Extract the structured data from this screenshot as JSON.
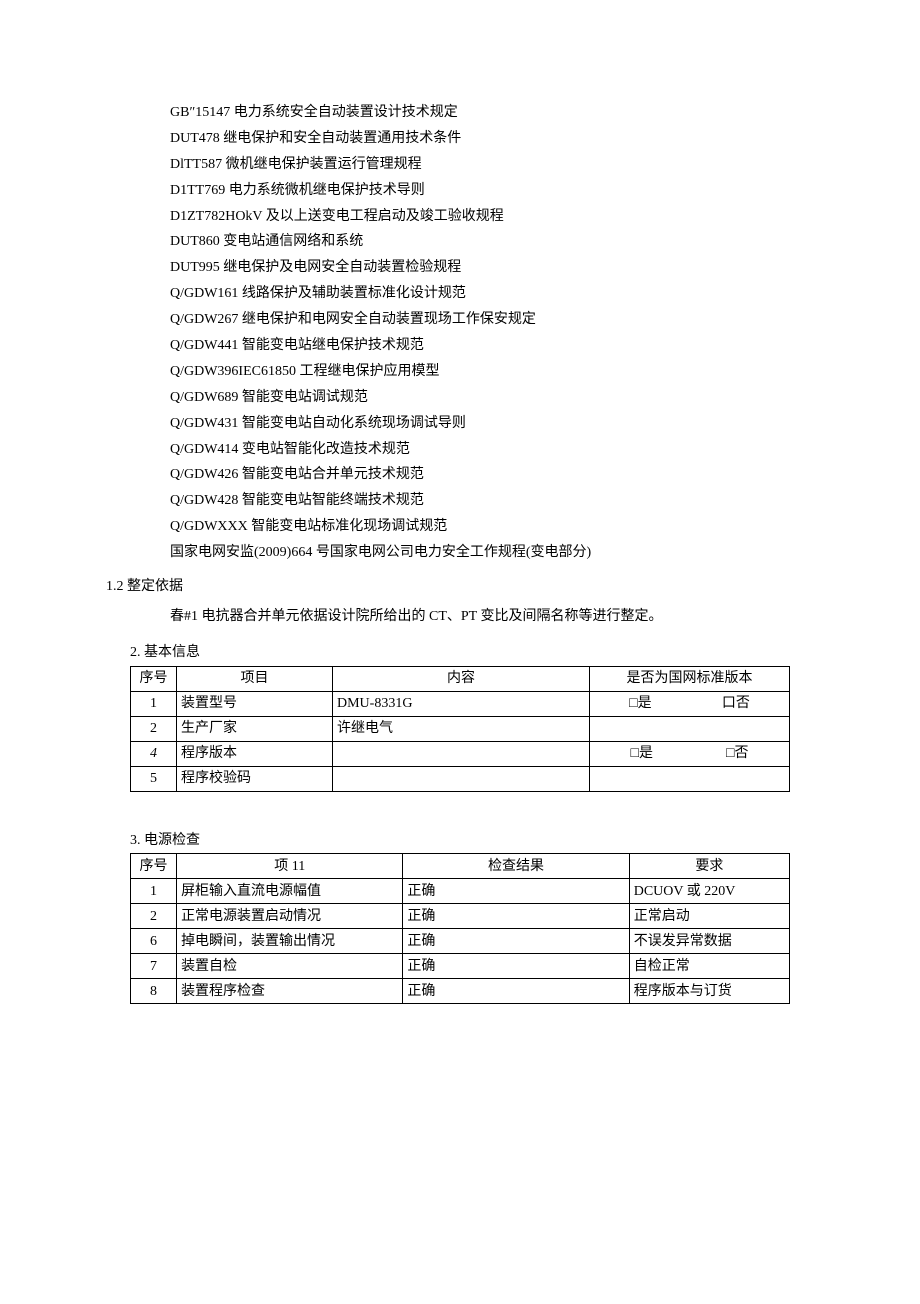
{
  "references": [
    "GB″15147 电力系统安全自动装置设计技术规定",
    "DUT478 继电保护和安全自动装置通用技术条件",
    "DlTT587 微机继电保护装置运行管理规程",
    "D1TT769 电力系统微机继电保护技术导则",
    "D1ZT782HOkV 及以上送变电工程启动及竣工验收规程",
    "DUT860 变电站通信网络和系统",
    "DUT995 继电保护及电网安全自动装置检验规程",
    "Q/GDW161 线路保护及辅助装置标准化设计规范",
    "Q/GDW267 继电保护和电网安全自动装置现场工作保安规定",
    "Q/GDW441 智能变电站继电保护技术规范",
    "Q/GDW396IEC61850 工程继电保护应用模型",
    "Q/GDW689 智能变电站调试规范",
    "Q/GDW431 智能变电站自动化系统现场调试导则",
    "Q/GDW414 变电站智能化改造技术规范",
    "Q/GDW426 智能变电站合并单元技术规范",
    "Q/GDW428 智能变电站智能终端技术规范",
    "Q/GDWXXX 智能变电站标准化现场调试规范",
    "国家电网安监(2009)664 号国家电网公司电力安全工作规程(变电部分)"
  ],
  "sec1_2": {
    "heading": "1.2  整定依据",
    "body": "春#1 电抗器合并单元依据设计院所给出的 CT、PT 变比及间隔名称等进行整定。"
  },
  "sec2": {
    "title": "2. 基本信息",
    "headers": [
      "序号",
      "项目",
      "内容",
      "是否为国网标准版本"
    ],
    "std_yes": "□是",
    "std_no": "口否",
    "std_no2": "□否",
    "rows": [
      {
        "seq": "1",
        "proj": "装置型号",
        "content": "DMU-8331G",
        "std": true
      },
      {
        "seq": "2",
        "proj": "生产厂家",
        "content": "许继电气",
        "std": false
      },
      {
        "seq": "4",
        "proj": "程序版本",
        "content": "",
        "std": true,
        "alt_no": true
      },
      {
        "seq": "5",
        "proj": "程序校验码",
        "content": "",
        "std": false
      }
    ]
  },
  "sec3": {
    "title": "3. 电源检查",
    "headers": [
      "序号",
      "项 11",
      "检查结果",
      "要求"
    ],
    "rows": [
      {
        "seq": "1",
        "item": "屏柜输入直流电源幅值",
        "res": "正确",
        "req": "DCUOV 或 220V"
      },
      {
        "seq": "2",
        "item": "正常电源装置启动情况",
        "res": "正确",
        "req": "正常启动"
      },
      {
        "seq": "6",
        "item": "掉电瞬间，装置输出情况",
        "res": "正确",
        "req": "不误发异常数据"
      },
      {
        "seq": "7",
        "item": "装置自检",
        "res": "正确",
        "req": "自检正常"
      },
      {
        "seq": "8",
        "item": "装置程序检查",
        "res": "正确",
        "req": "程序版本与订货"
      }
    ]
  }
}
